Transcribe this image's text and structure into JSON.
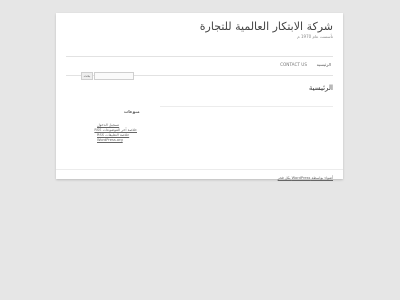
{
  "site": {
    "title": "شركة الابتكار العالمية للتجارة",
    "description": "تأسست عام 1970 م"
  },
  "nav": {
    "items": [
      {
        "label": "الرئيسية"
      },
      {
        "label": "CONTACT US"
      }
    ]
  },
  "main": {
    "title": "الرئيسية"
  },
  "sidebar": {
    "search_button": "بحث",
    "meta_title": "منوعات",
    "meta_links": [
      {
        "label": "تسجيل الدخول"
      },
      {
        "label": "خلاصة آخر الموضوعات RSS"
      },
      {
        "label": "خلاصة التعليقات RSS"
      },
      {
        "label": "WordPress.org"
      }
    ]
  },
  "footer": {
    "text": "أضواء بواسطة WordPress بكل فخر"
  }
}
